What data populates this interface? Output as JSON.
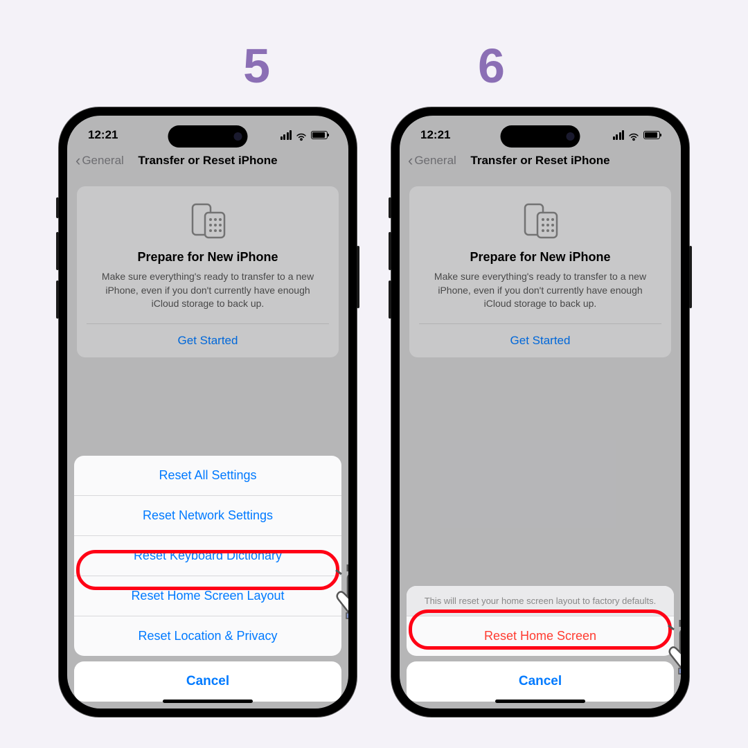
{
  "steps": {
    "left": "5",
    "right": "6"
  },
  "status": {
    "time": "12:21"
  },
  "nav": {
    "back": "General",
    "title": "Transfer or Reset iPhone"
  },
  "card": {
    "title": "Prepare for New iPhone",
    "desc": "Make sure everything's ready to transfer to a new iPhone, even if you don't currently have enough iCloud storage to back up.",
    "cta": "Get Started"
  },
  "sheet5": {
    "items": [
      "Reset All Settings",
      "Reset Network Settings",
      "Reset Keyboard Dictionary",
      "Reset Home Screen Layout",
      "Reset Location & Privacy"
    ],
    "cancel": "Cancel"
  },
  "sheet6": {
    "header": "This will reset your home screen layout to factory defaults.",
    "confirm": "Reset Home Screen",
    "cancel": "Cancel"
  }
}
